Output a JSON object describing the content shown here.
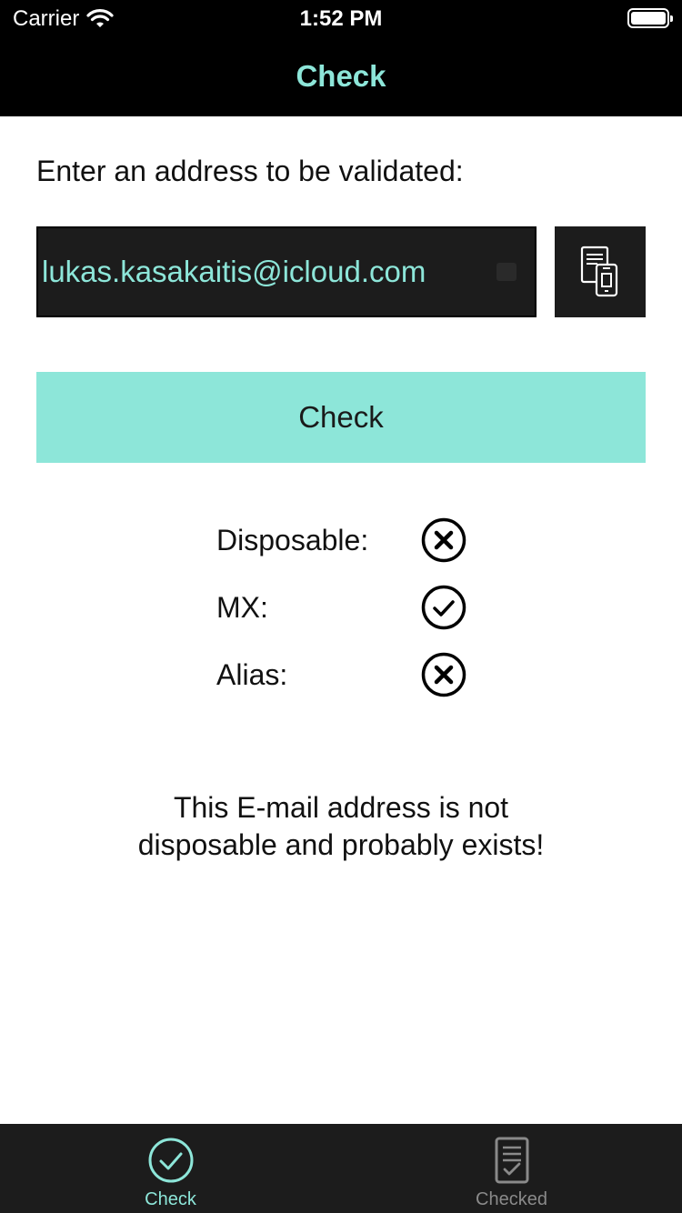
{
  "status_bar": {
    "carrier": "Carrier",
    "time": "1:52 PM"
  },
  "nav": {
    "title": "Check"
  },
  "form": {
    "prompt": "Enter an address to be validated:",
    "email_value": "lukas.kasakaitis@icloud.com",
    "paste_icon": "paste-from-clipboard-icon",
    "check_label": "Check"
  },
  "results": [
    {
      "label": "Disposable:",
      "status": "no",
      "icon": "x-circle-icon"
    },
    {
      "label": "MX:",
      "status": "yes",
      "icon": "check-circle-icon"
    },
    {
      "label": "Alias:",
      "status": "no",
      "icon": "x-circle-icon"
    }
  ],
  "summary": "This E-mail address is not disposable and probably exists!",
  "tabs": [
    {
      "label": "Check",
      "icon": "check-circle-icon",
      "active": true
    },
    {
      "label": "Checked",
      "icon": "checklist-document-icon",
      "active": false
    }
  ],
  "colors": {
    "accent": "#8de6d9",
    "dark": "#1c1c1c",
    "inactive_tab": "#8a8a8a"
  }
}
